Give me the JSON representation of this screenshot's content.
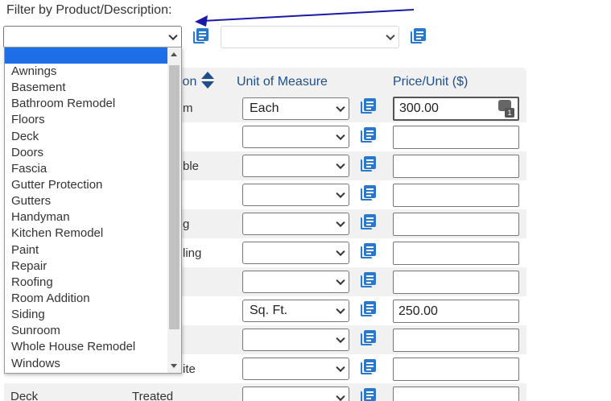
{
  "filter": {
    "label": "Filter by Product/Description:",
    "product_select_value": "",
    "second_select_value": ""
  },
  "dropdown": {
    "options": [
      "",
      "Awnings",
      "Basement",
      "Bathroom Remodel",
      "Floors",
      "Deck",
      "Doors",
      "Fascia",
      "Gutter Protection",
      "Gutters",
      "Handyman",
      "Kitchen Remodel",
      "Paint",
      "Repair",
      "Roofing",
      "Room Addition",
      "Siding",
      "Sunroom",
      "Whole House Remodel",
      "Windows"
    ],
    "selected_index": 0
  },
  "table": {
    "headers": {
      "description_partial": "ion",
      "unit": "Unit of Measure",
      "price": "Price/Unit ($)"
    },
    "rows": [
      {
        "desc_partial": "m",
        "unit": "Each",
        "price": "300.00"
      },
      {
        "desc_partial": "",
        "unit": "",
        "price": ""
      },
      {
        "desc_partial": "ble",
        "unit": "",
        "price": ""
      },
      {
        "desc_partial": "",
        "unit": "",
        "price": ""
      },
      {
        "desc_partial": "g",
        "unit": "",
        "price": ""
      },
      {
        "desc_partial": "ling",
        "unit": "",
        "price": ""
      },
      {
        "desc_partial": "",
        "unit": "",
        "price": ""
      },
      {
        "desc_partial": "",
        "unit": "Sq. Ft.",
        "price": "250.00"
      },
      {
        "desc_partial": "",
        "unit": "",
        "price": ""
      },
      {
        "desc_partial": "ite",
        "unit": "",
        "price": ""
      },
      {
        "product": "Deck",
        "desc_partial": "Treated",
        "unit": "",
        "price": ""
      }
    ]
  },
  "icons": {
    "list": "list-copy-icon",
    "calculator": "calculator-icon",
    "sort": "sort-icon"
  },
  "colors": {
    "accent": "#2b78c9",
    "header_text": "#1e4e8c",
    "selection": "#1e6fe7",
    "arrow": "#1a1aa6"
  }
}
